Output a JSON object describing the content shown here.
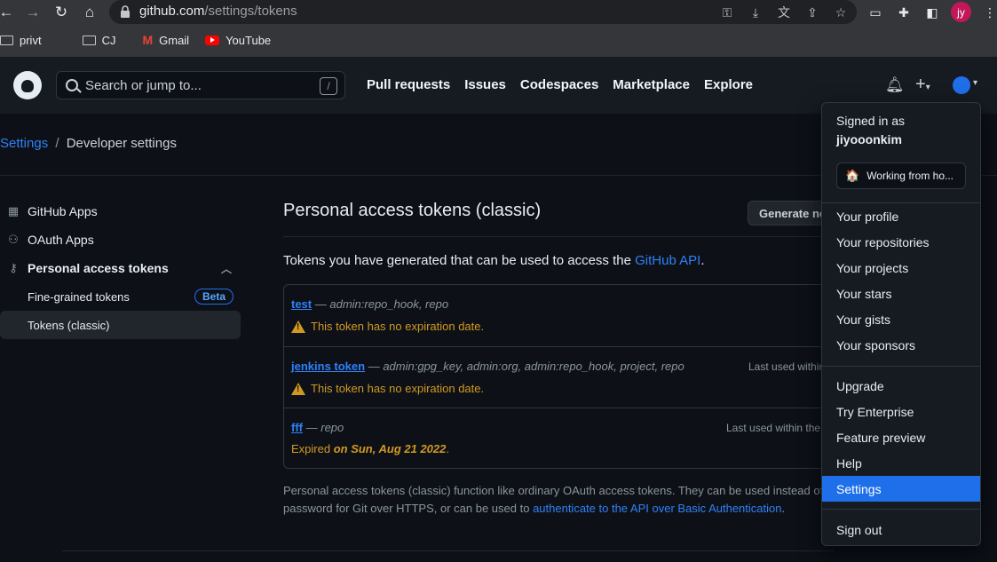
{
  "browser": {
    "url_host": "github.com",
    "url_path": "/settings/tokens",
    "profile_initials": "jy",
    "bookmarks": [
      {
        "label": "privt",
        "icon": "folder-icon"
      },
      {
        "label": "CJ",
        "icon": "folder-icon"
      },
      {
        "label": "Gmail",
        "icon": "gmail-icon"
      },
      {
        "label": "YouTube",
        "icon": "youtube-icon"
      }
    ]
  },
  "header": {
    "search_placeholder": "Search or jump to...",
    "search_shortcut": "/",
    "nav": [
      "Pull requests",
      "Issues",
      "Codespaces",
      "Marketplace",
      "Explore"
    ]
  },
  "breadcrumb": {
    "root": "Settings",
    "separator": "/",
    "current": "Developer settings"
  },
  "sidebar": {
    "items": [
      {
        "label": "GitHub Apps",
        "icon": "apps-grid-icon"
      },
      {
        "label": "OAuth Apps",
        "icon": "person-icon"
      },
      {
        "label": "Personal access tokens",
        "icon": "key-icon"
      }
    ],
    "subitems": [
      {
        "label": "Fine-grained tokens",
        "badge": "Beta"
      },
      {
        "label": "Tokens (classic)"
      }
    ]
  },
  "main": {
    "title": "Personal access tokens (classic)",
    "generate_label": "Generate new token",
    "intro_prefix": "Tokens you have generated that can be used to access the ",
    "intro_link": "GitHub API",
    "intro_suffix": ".",
    "tokens": [
      {
        "name": "test",
        "dash": " — ",
        "scopes": "admin:repo_hook, repo",
        "last_used": "",
        "warning": "This token has no expiration date."
      },
      {
        "name": "jenkins token",
        "dash": " — ",
        "scopes": "admin:gpg_key, admin:org, admin:repo_hook, project, repo",
        "last_used": "Last used within",
        "warning": "This token has no expiration date."
      },
      {
        "name": "fff",
        "dash": " — ",
        "scopes": "repo",
        "last_used": "Last used within the",
        "expired_prefix": "Expired ",
        "expired_date": "on Sun, Aug 21 2022",
        "expired_suffix": "."
      }
    ],
    "footer_prefix": "Personal access tokens (classic) function like ordinary OAuth access tokens. They can be used instead of a password for Git over HTTPS, or can be used to ",
    "footer_link": "authenticate to the API over Basic Authentication",
    "footer_suffix": "."
  },
  "dropdown": {
    "signed_in_as": "Signed in as",
    "username": "jiyooonkim",
    "status": "Working from ho...",
    "group1": [
      "Your profile",
      "Your repositories",
      "Your projects",
      "Your stars",
      "Your gists",
      "Your sponsors"
    ],
    "group2": [
      "Upgrade",
      "Try Enterprise",
      "Feature preview",
      "Help",
      "Settings"
    ],
    "sign_out": "Sign out",
    "active_item": "Settings"
  }
}
